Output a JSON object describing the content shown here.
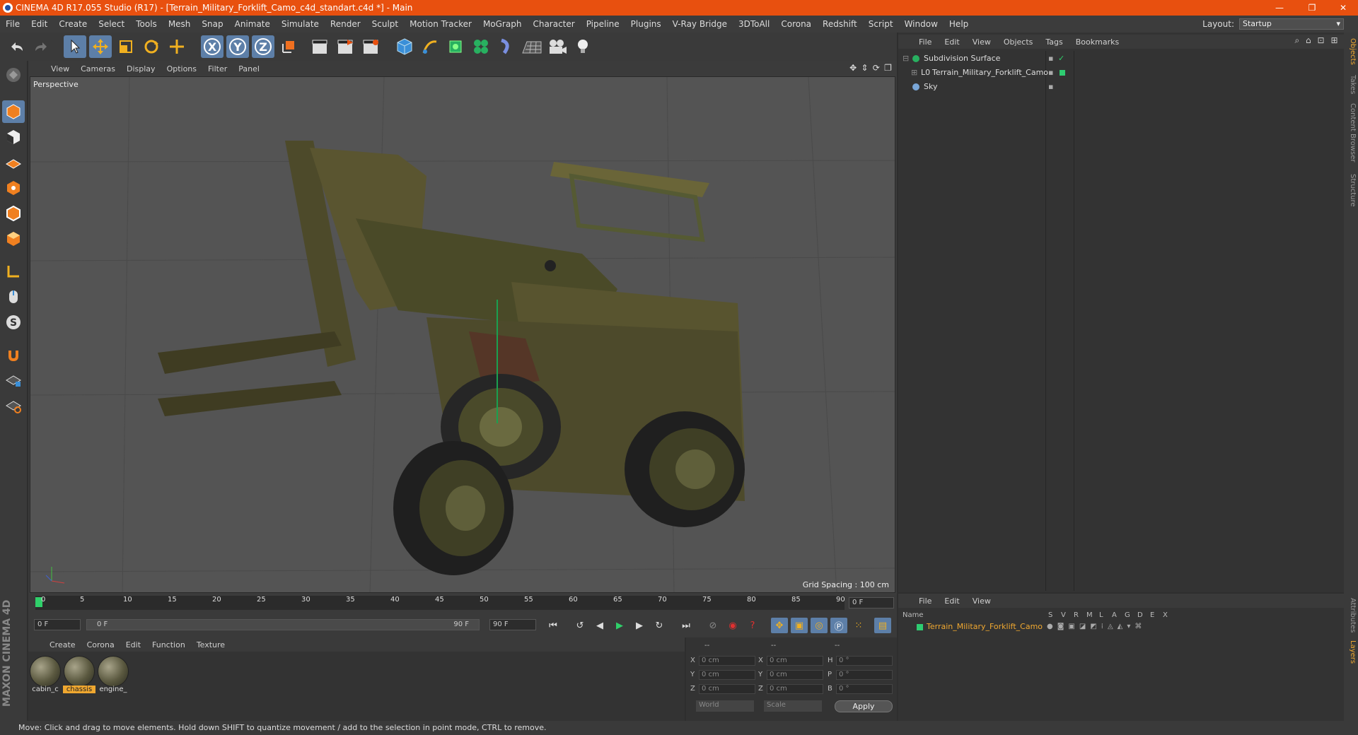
{
  "title": "CINEMA 4D R17.055 Studio (R17) - [Terrain_Military_Forklift_Camo_c4d_standart.c4d *] - Main",
  "window_controls": [
    "—",
    "❐",
    "✕"
  ],
  "menu": [
    "File",
    "Edit",
    "Create",
    "Select",
    "Tools",
    "Mesh",
    "Snap",
    "Animate",
    "Simulate",
    "Render",
    "Sculpt",
    "Motion Tracker",
    "MoGraph",
    "Character",
    "Pipeline",
    "Plugins",
    "V-Ray Bridge",
    "3DToAll",
    "Corona",
    "Redshift",
    "Script",
    "Window",
    "Help"
  ],
  "layout": {
    "label": "Layout:",
    "value": "Startup"
  },
  "toolbar": {
    "x": "X",
    "y": "Y",
    "z": "Z"
  },
  "viewport": {
    "menu": [
      "View",
      "Cameras",
      "Display",
      "Options",
      "Filter",
      "Panel"
    ],
    "camera": "Perspective",
    "grid_spacing": "Grid Spacing : 100 cm"
  },
  "timeline": {
    "ticks": [
      "0",
      "5",
      "10",
      "15",
      "20",
      "25",
      "30",
      "35",
      "40",
      "45",
      "50",
      "55",
      "60",
      "65",
      "70",
      "75",
      "80",
      "85",
      "90"
    ],
    "current_frame": "0 F",
    "start": "0 F",
    "range_start": "0 F",
    "range_end": "90 F",
    "end": "90 F"
  },
  "materials": {
    "menu": [
      "Create",
      "Corona",
      "Edit",
      "Function",
      "Texture"
    ],
    "items": [
      {
        "name": "cabin_c",
        "selected": false
      },
      {
        "name": "chassis",
        "selected": true
      },
      {
        "name": "engine_",
        "selected": false
      }
    ]
  },
  "coords": {
    "header": [
      "--",
      "--",
      "--"
    ],
    "rows": [
      {
        "a": "X",
        "av": "0 cm",
        "b": "X",
        "bv": "0 cm",
        "c": "H",
        "cv": "0 °"
      },
      {
        "a": "Y",
        "av": "0 cm",
        "b": "Y",
        "bv": "0 cm",
        "c": "P",
        "cv": "0 °"
      },
      {
        "a": "Z",
        "av": "0 cm",
        "b": "Z",
        "bv": "0 cm",
        "c": "B",
        "cv": "0 °"
      }
    ],
    "world": "World",
    "scale": "Scale",
    "apply": "Apply"
  },
  "objects": {
    "menu": [
      "File",
      "Edit",
      "View",
      "Objects",
      "Tags",
      "Bookmarks"
    ],
    "items": [
      "Subdivision Surface",
      "Terrain_Military_Forklift_Camo",
      "Sky"
    ]
  },
  "layers": {
    "menu": [
      "File",
      "Edit",
      "View"
    ],
    "columns": [
      "Name",
      "S",
      "V",
      "R",
      "M",
      "L",
      "A",
      "G",
      "D",
      "E",
      "X"
    ],
    "item": "Terrain_Military_Forklift_Camo"
  },
  "side_tabs": [
    "Objects",
    "Takes",
    "Content Browser",
    "Structure",
    "Attributes",
    "Layers"
  ],
  "brand": "MAXON CINEMA 4D",
  "status": "Move: Click and drag to move elements. Hold down SHIFT to quantize movement / add to the selection in point mode, CTRL to remove.",
  "colors": {
    "accent": "#e8500f",
    "select": "#5d7fa8",
    "layer_green": "#2ecc71",
    "highlight": "#f0a830"
  }
}
